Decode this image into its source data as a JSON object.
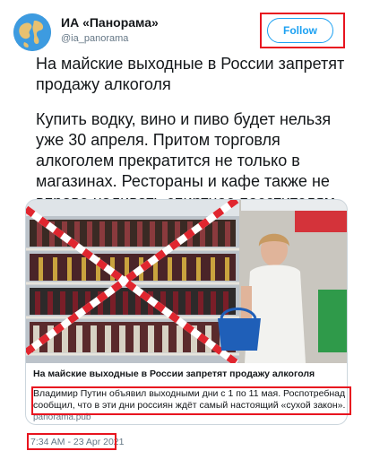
{
  "author": {
    "name": "ИА «Панорама»",
    "handle": "@ia_panorama",
    "avatar_icon": "globe-avatar-icon"
  },
  "follow_label": "Follow",
  "tweet": {
    "paragraph1": "На майские выходные в России запретят продажу алкоголя",
    "paragraph2": "Купить водку, вино и пиво будет нельзя уже 30 апреля. Притом торговля алкоголем прекратится не только в магазинах. Рестораны и кафе также не вправе наливать спиртное посетителям."
  },
  "card": {
    "image_icon": "photo-liquor-shelves-crossed-tape",
    "title": "На майские выходные в России запретят продажу алкоголя",
    "description_line1": "Владимир Путин объявил выходными дни с 1 по 11 мая. Роспотребнадзор",
    "description_line2": "сообщил, что в эти дни россиян ждёт самый настоящий «сухой закон».Купит...",
    "domain": "panorama.pub"
  },
  "timestamp": "7:34 AM - 23 Apr 2021",
  "colors": {
    "accent": "#1da1f2",
    "highlight": "#e8141f",
    "secondary_text": "#657786"
  }
}
